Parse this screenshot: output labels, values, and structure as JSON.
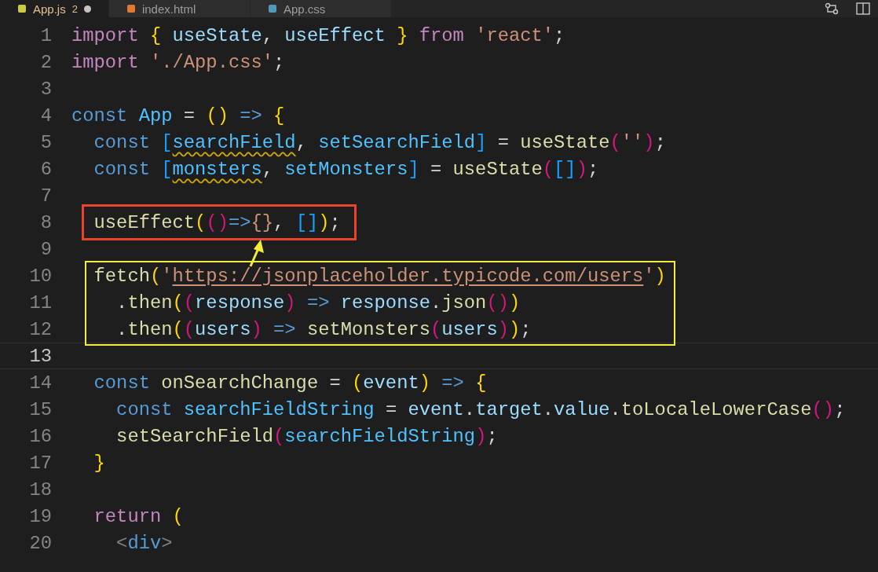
{
  "tabs": [
    {
      "label": "App.js",
      "kind": "js",
      "selected": true,
      "badge": "2",
      "modified": true
    },
    {
      "label": "index.html",
      "kind": "html",
      "selected": false,
      "modified": false
    },
    {
      "label": "App.css",
      "kind": "css",
      "selected": false,
      "modified": false
    }
  ],
  "lines": [
    {
      "number": "1",
      "tokens": [
        {
          "t": "import ",
          "kind": "ctl"
        },
        {
          "t": "{ ",
          "kind": "y"
        },
        {
          "t": "useState",
          "kind": "var"
        },
        {
          "t": ", ",
          "kind": "pl"
        },
        {
          "t": "useEffect ",
          "kind": "var"
        },
        {
          "t": "} ",
          "kind": "y"
        },
        {
          "t": "from ",
          "kind": "ctl"
        },
        {
          "t": "'react'",
          "kind": "str"
        },
        {
          "t": ";",
          "kind": "pl"
        }
      ]
    },
    {
      "number": "2",
      "tokens": [
        {
          "t": "import ",
          "kind": "ctl"
        },
        {
          "t": "'./App.css'",
          "kind": "str"
        },
        {
          "t": ";",
          "kind": "pl"
        }
      ]
    },
    {
      "number": "3"
    },
    {
      "number": "4",
      "tokens": [
        {
          "t": "const ",
          "kind": "kw"
        },
        {
          "t": "App ",
          "kind": "cst"
        },
        {
          "t": "= ",
          "kind": "pl"
        },
        {
          "t": "() ",
          "kind": "y"
        },
        {
          "t": "=> ",
          "kind": "kw"
        },
        {
          "t": "{",
          "kind": "y"
        }
      ]
    },
    {
      "number": "5",
      "tokens": [
        {
          "t": "  const ",
          "kind": "kw"
        },
        {
          "t": "[",
          "kind": "b"
        },
        {
          "t": "searchField",
          "kind": "cst",
          "warn": true
        },
        {
          "t": ", ",
          "kind": "pl"
        },
        {
          "t": "setSearchField",
          "kind": "cst"
        },
        {
          "t": "] ",
          "kind": "b"
        },
        {
          "t": "= ",
          "kind": "pl"
        },
        {
          "t": "useState",
          "kind": "fn"
        },
        {
          "t": "(",
          "kind": "p"
        },
        {
          "t": "''",
          "kind": "str"
        },
        {
          "t": ")",
          "kind": "p"
        },
        {
          "t": ";",
          "kind": "pl"
        }
      ]
    },
    {
      "number": "6",
      "tokens": [
        {
          "t": "  const ",
          "kind": "kw"
        },
        {
          "t": "[",
          "kind": "b"
        },
        {
          "t": "monsters",
          "kind": "cst",
          "warn": true
        },
        {
          "t": ", ",
          "kind": "pl"
        },
        {
          "t": "setMonsters",
          "kind": "cst"
        },
        {
          "t": "] ",
          "kind": "b"
        },
        {
          "t": "= ",
          "kind": "pl"
        },
        {
          "t": "useState",
          "kind": "fn"
        },
        {
          "t": "(",
          "kind": "p"
        },
        {
          "t": "[]",
          "kind": "b"
        },
        {
          "t": ")",
          "kind": "p"
        },
        {
          "t": ";",
          "kind": "pl"
        }
      ]
    },
    {
      "number": "7"
    },
    {
      "number": "8",
      "box": {
        "color": "#e8432c"
      },
      "arrow": {
        "color": "#f5ec3a"
      },
      "tokens": [
        {
          "t": "  useEffect",
          "kind": "fn"
        },
        {
          "t": "(",
          "kind": "y"
        },
        {
          "t": "()",
          "kind": "p"
        },
        {
          "t": "=>",
          "kind": "kw"
        },
        {
          "t": "{}",
          "kind": "str"
        },
        {
          "t": ", ",
          "kind": "pl"
        },
        {
          "t": "[]",
          "kind": "b"
        },
        {
          "t": ")",
          "kind": "y"
        },
        {
          "t": ";",
          "kind": "pl"
        }
      ]
    },
    {
      "number": "9"
    },
    {
      "number": "10",
      "box": {
        "color": "#f5ec3a"
      },
      "tokens": [
        {
          "t": "  fetch",
          "kind": "fn"
        },
        {
          "t": "(",
          "kind": "y"
        },
        {
          "t": "'",
          "kind": "str"
        },
        {
          "t": "https://jsonplaceholder.typicode.com/users",
          "kind": "str",
          "link": true
        },
        {
          "t": "'",
          "kind": "str"
        },
        {
          "t": ")",
          "kind": "y"
        }
      ]
    },
    {
      "number": "11",
      "box": {
        "color": "#f5ec3a"
      },
      "tokens": [
        {
          "t": "    .",
          "kind": "pl"
        },
        {
          "t": "then",
          "kind": "fn"
        },
        {
          "t": "(",
          "kind": "y"
        },
        {
          "t": "(",
          "kind": "p"
        },
        {
          "t": "response",
          "kind": "var"
        },
        {
          "t": ") ",
          "kind": "p"
        },
        {
          "t": "=> ",
          "kind": "kw"
        },
        {
          "t": "response",
          "kind": "var"
        },
        {
          "t": ".",
          "kind": "pl"
        },
        {
          "t": "json",
          "kind": "fn"
        },
        {
          "t": "()",
          "kind": "p"
        },
        {
          "t": ")",
          "kind": "y"
        }
      ]
    },
    {
      "number": "12",
      "box": {
        "color": "#f5ec3a"
      },
      "tokens": [
        {
          "t": "    .",
          "kind": "pl"
        },
        {
          "t": "then",
          "kind": "fn"
        },
        {
          "t": "(",
          "kind": "y"
        },
        {
          "t": "(",
          "kind": "p"
        },
        {
          "t": "users",
          "kind": "var"
        },
        {
          "t": ") ",
          "kind": "p"
        },
        {
          "t": "=> ",
          "kind": "kw"
        },
        {
          "t": "setMonsters",
          "kind": "fn"
        },
        {
          "t": "(",
          "kind": "p"
        },
        {
          "t": "users",
          "kind": "var"
        },
        {
          "t": ")",
          "kind": "p"
        },
        {
          "t": ")",
          "kind": "y"
        },
        {
          "t": ";",
          "kind": "pl"
        }
      ]
    },
    {
      "number": "13",
      "current": true
    },
    {
      "number": "14",
      "tokens": [
        {
          "t": "  const ",
          "kind": "kw"
        },
        {
          "t": "onSearchChange ",
          "kind": "fn"
        },
        {
          "t": "= ",
          "kind": "pl"
        },
        {
          "t": "(",
          "kind": "y"
        },
        {
          "t": "event",
          "kind": "var"
        },
        {
          "t": ") ",
          "kind": "y"
        },
        {
          "t": "=> ",
          "kind": "kw"
        },
        {
          "t": "{",
          "kind": "y"
        }
      ]
    },
    {
      "number": "15",
      "tokens": [
        {
          "t": "    const ",
          "kind": "kw"
        },
        {
          "t": "searchFieldString ",
          "kind": "cst"
        },
        {
          "t": "= ",
          "kind": "pl"
        },
        {
          "t": "event",
          "kind": "var"
        },
        {
          "t": ".",
          "kind": "pl"
        },
        {
          "t": "target",
          "kind": "var"
        },
        {
          "t": ".",
          "kind": "pl"
        },
        {
          "t": "value",
          "kind": "var"
        },
        {
          "t": ".",
          "kind": "pl"
        },
        {
          "t": "toLocaleLowerCase",
          "kind": "fn"
        },
        {
          "t": "()",
          "kind": "p"
        },
        {
          "t": ";",
          "kind": "pl"
        }
      ]
    },
    {
      "number": "16",
      "tokens": [
        {
          "t": "    setSearchField",
          "kind": "fn"
        },
        {
          "t": "(",
          "kind": "p"
        },
        {
          "t": "searchFieldString",
          "kind": "cst"
        },
        {
          "t": ")",
          "kind": "p"
        },
        {
          "t": ";",
          "kind": "pl"
        }
      ]
    },
    {
      "number": "17",
      "tokens": [
        {
          "t": "  }",
          "kind": "y"
        }
      ]
    },
    {
      "number": "18"
    },
    {
      "number": "19",
      "tokens": [
        {
          "t": "  return ",
          "kind": "ctl"
        },
        {
          "t": "(",
          "kind": "y"
        }
      ]
    },
    {
      "number": "20",
      "tokens": [
        {
          "t": "    <",
          "kind": "tag"
        },
        {
          "t": "div",
          "kind": "kw"
        },
        {
          "t": ">",
          "kind": "tag"
        }
      ]
    }
  ]
}
